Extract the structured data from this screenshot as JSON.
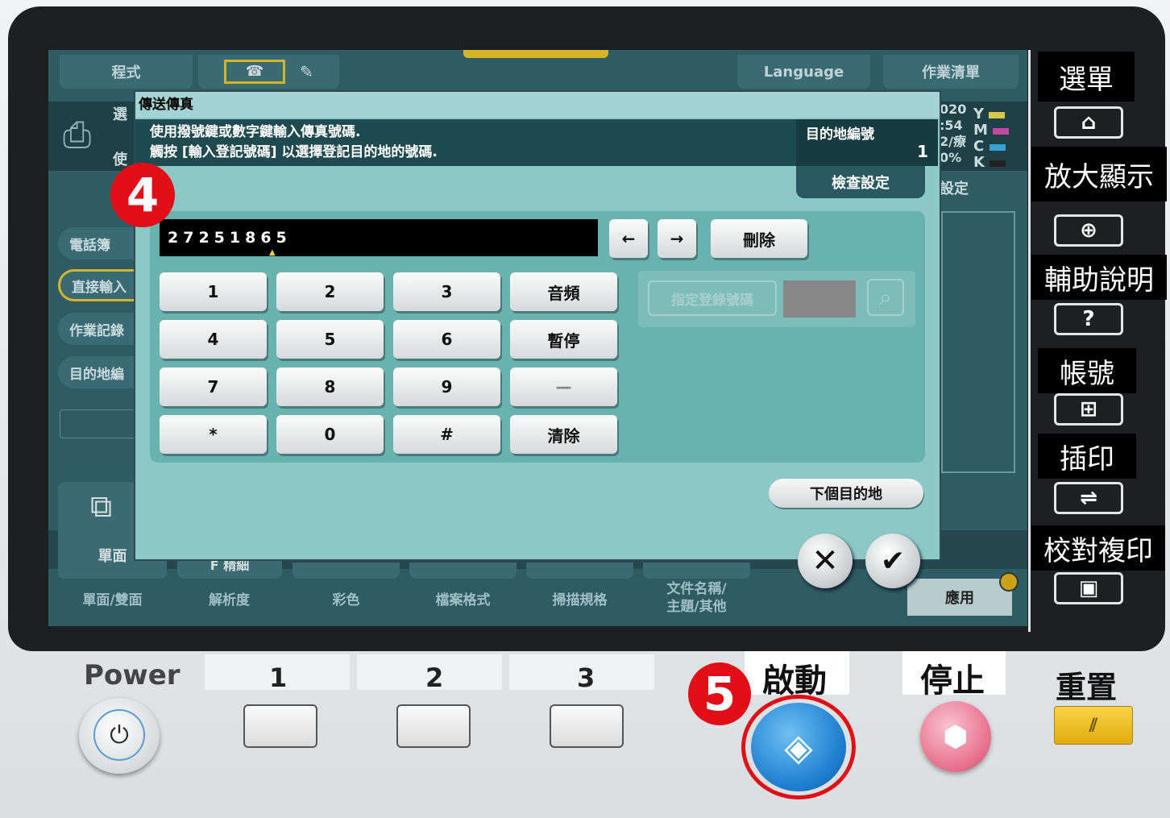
{
  "top_tabs": {
    "program": "程式",
    "language": "Language",
    "job_list": "作業清單"
  },
  "side_menu": [
    {
      "label": "電話簿"
    },
    {
      "label": "直接輸入"
    },
    {
      "label": "作業記錄"
    },
    {
      "label": "目的地編"
    }
  ],
  "bg_partial": {
    "select_a": "選",
    "select_b": "使",
    "time_a": "020",
    "time_b": ":54",
    "time_c": "0%",
    "time_d": "2/療",
    "settings": "設定",
    "ymck": [
      "Y",
      "M",
      "C",
      "K"
    ]
  },
  "bottom_tabs": [
    "單面/雙面",
    "解析度",
    "彩色",
    "檔案格式",
    "掃描規格",
    "文件名稱/\n主題/其他"
  ],
  "bottom_icon_label": "單面",
  "bottom_partial": "F 精細",
  "apply_button": "應用",
  "dialog": {
    "title": "傳送傳真",
    "instruction_line1": "使用撥號鍵或數字鍵輸入傳真號碼.",
    "instruction_line2": "觸按 [輸入登記號碼] 以選擇登記目的地的號碼.",
    "dest_label": "目的地編號",
    "dest_count": "1",
    "check_settings": "檢查設定",
    "fax_number": "27251865",
    "left_arrow": "←",
    "right_arrow": "→",
    "delete": "刪除",
    "keys": [
      "1",
      "2",
      "3",
      "音頻",
      "4",
      "5",
      "6",
      "暫停",
      "7",
      "8",
      "9",
      "—",
      "*",
      "0",
      "#",
      "清除"
    ],
    "registered_number": "指定登錄號碼",
    "next_destination": "下個目的地",
    "cancel_symbol": "✕",
    "ok_symbol": "✔"
  },
  "right_panel": {
    "menu": "選單",
    "zoom": "放大顯示",
    "help": "輔助說明",
    "help_symbol": "?",
    "account": "帳號",
    "interrupt": "插印",
    "proof_copy": "校對複印"
  },
  "hardware": {
    "power": "Power",
    "keys": [
      "1",
      "2",
      "3"
    ],
    "start": "啟動",
    "stop": "停止",
    "reset": "重置"
  },
  "steps": {
    "step4": "4",
    "step5": "5"
  },
  "colors": {
    "accent_red": "#e20e17",
    "start_blue": "#1e7fd0",
    "stop_pink": "#e8748f",
    "reset_yellow": "#f2c21a"
  }
}
